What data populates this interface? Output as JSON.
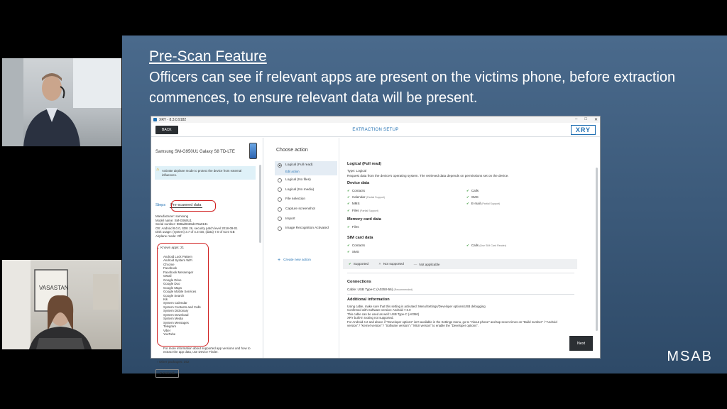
{
  "slide": {
    "title": "Pre-Scan Feature",
    "body": "Officers can see if relevant apps are present on the victims phone, before extraction commences, to ensure relevant data will be present.",
    "brand": "MSAB"
  },
  "window": {
    "title": "XRY - 8.3.0.9182",
    "back_label": "BACK",
    "header": "EXTRACTION SETUP",
    "logo": "XRY"
  },
  "left": {
    "device_name": "Samsung SM-G950U1 Galaxy S8 TD-LTE",
    "alert": "Activate airplane mode to protect the device from external influences.",
    "tab_steps": "Steps",
    "tab_prescan": "Pre-scanned data",
    "info": [
      "Manufacturer: samsung",
      "Model name: SM-G950U1",
      "Serial number: 988ad9465d475a0131",
      "OS: Android 8.0.0, SDK 26, security patch level 2018-09-01",
      "Disk usage: (system) 3.7 of 4.3 GB, (data) 7.0 of 53.0 GB",
      "Airplane mode: Off"
    ],
    "known_apps": "Known apps: 21",
    "apps": [
      "Android Lock Pattern",
      "Android System WiFi",
      "Chrome",
      "Facebook",
      "Facebook Messenger",
      "GMail",
      "Google Drive",
      "Google Duo",
      "Google Maps",
      "Google Mobile Services",
      "Google Search",
      "Kik",
      "System Calendar",
      "System Contacts and Calls",
      "System Dictionary",
      "System Download",
      "System Media",
      "System Messages",
      "Telegram",
      "Viber",
      "YouTube"
    ],
    "more_info": "For more information about supported app versions and how to extract the app data, use Device Finder.",
    "other_packages": "Other packages: 352",
    "refresh_label": "Refresh"
  },
  "middle": {
    "heading": "Choose action",
    "actions": [
      "Logical (Full read)",
      "Logical (No files)",
      "Logical (No media)",
      "File selection",
      "Capture screenshot",
      "Import",
      "Image Recognition Activated"
    ],
    "edit_label": "Edit action",
    "create_label": "Create new action"
  },
  "right": {
    "title": "Logical (Full read)",
    "type": "Type: Logical",
    "description": "Request data from the device's operating system. The retrieved data depends on permissions set on the device.",
    "device_data_heading": "Device data",
    "device_data": [
      {
        "label": "Contacts",
        "note": ""
      },
      {
        "label": "Calls",
        "note": ""
      },
      {
        "label": "Calendar",
        "note": "(Partial Support)"
      },
      {
        "label": "SMS",
        "note": ""
      },
      {
        "label": "MMS",
        "note": ""
      },
      {
        "label": "E-mail",
        "note": "(Partial Support)"
      },
      {
        "label": "Files",
        "note": "(Partial Support)"
      }
    ],
    "memory_heading": "Memory card data",
    "memory_items": [
      "Files"
    ],
    "sim_heading": "SIM card data",
    "sim_data": [
      {
        "label": "Contacts",
        "note": ""
      },
      {
        "label": "Calls",
        "note": "(Use SIM Card Reader)"
      },
      {
        "label": "SMS",
        "note": ""
      }
    ],
    "legend": {
      "supported": "Supported",
      "not_supported": "Not supported",
      "not_applicable": "Not applicable"
    },
    "connections_heading": "Connections",
    "cable": "Cable: USB Type-C (A0350-56)",
    "cable_note": "(Recommended)",
    "additional_heading": "Additional information",
    "additional": [
      "Using cable, make sure that this setting is activated: Menu/Settings/Developer options/USB debugging",
      "Confirmed with Software version: Android 7.0.0",
      "This cable can be used as well: USB Type-C (A0350)",
      "XRY built-in rooting not supported.",
      "For Android 4.2 and above if \"Developer options\" isn't available in the Settings menu, go to \"About phone\" and tap seven times on \"Build number\" / \"Android",
      "version\" / \"Kernel version\" / \"Software version\" / \"MIUI version\" to enable the \"Developer options\"."
    ],
    "next_label": "Next"
  },
  "colors": {
    "accent": "#1f6fb2",
    "highlight": "#d02020",
    "slide_bg": "#3c5a7a",
    "check": "#3a9a3a"
  }
}
